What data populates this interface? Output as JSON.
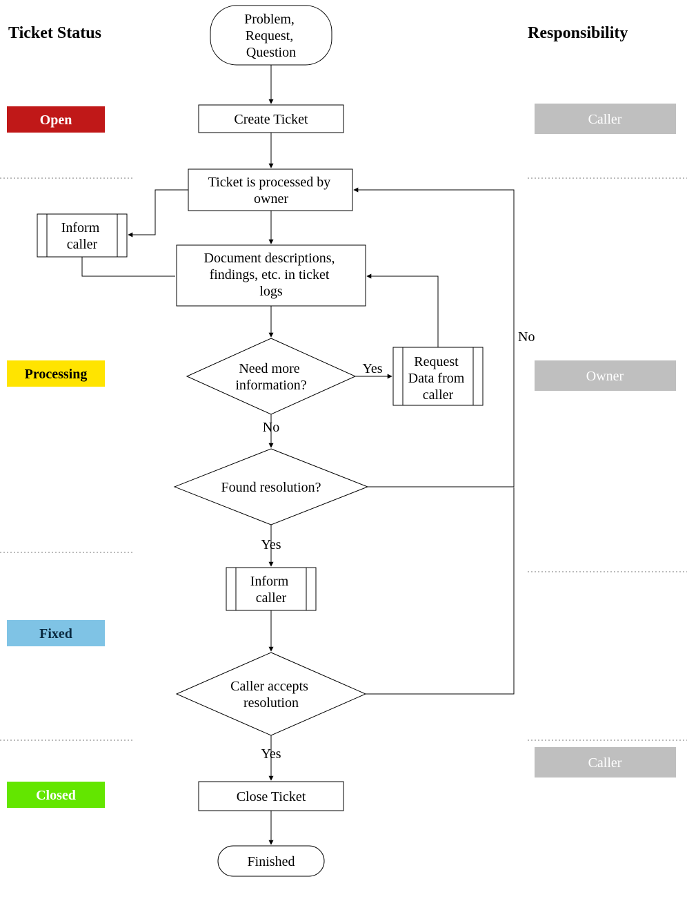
{
  "headings": {
    "left": "Ticket Status",
    "right": "Responsibility"
  },
  "status": {
    "open": {
      "label": "Open",
      "bg": "#c01818",
      "fg": "#ffffff"
    },
    "processing": {
      "label": "Processing",
      "bg": "#ffe400",
      "fg": "#000000"
    },
    "fixed": {
      "label": "Fixed",
      "bg": "#7fc3e5",
      "fg": "#0a2a40"
    },
    "closed": {
      "label": "Closed",
      "bg": "#63e600",
      "fg": "#ffffff"
    }
  },
  "responsibility": {
    "caller_top": {
      "label": "Caller",
      "bg": "#bfbfbf"
    },
    "owner": {
      "label": "Owner",
      "bg": "#bfbfbf"
    },
    "caller_bottom": {
      "label": "Caller",
      "bg": "#bfbfbf"
    }
  },
  "nodes": {
    "start": "Problem, Request, Question",
    "create": "Create Ticket",
    "processed": "Ticket is processed by owner",
    "inform1_l1": "Inform",
    "inform1_l2": "caller",
    "document_l1": "Document descriptions,",
    "document_l2": "findings, etc. in ticket",
    "document_l3": "logs",
    "needmore_l1": "Need more",
    "needmore_l2": "information?",
    "request_l1": "Request",
    "request_l2": "Data from",
    "request_l3": "caller",
    "foundres": "Found resolution?",
    "inform2_l1": "Inform",
    "inform2_l2": "caller",
    "accepts_l1": "Caller accepts",
    "accepts_l2": "resolution",
    "close": "Close Ticket",
    "finished": "Finished"
  },
  "edges": {
    "yes": "Yes",
    "no": "No"
  },
  "colors": {
    "stroke": "#000000",
    "dotted": "#777777"
  }
}
